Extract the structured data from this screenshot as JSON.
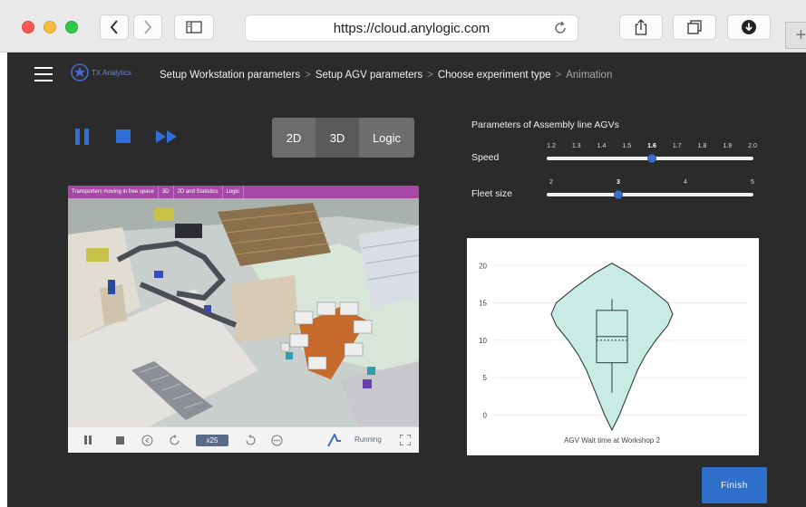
{
  "browser": {
    "url": "https://cloud.anylogic.com",
    "new_tab": "+"
  },
  "header": {
    "logo_text": "TX Analytics",
    "breadcrumbs": [
      {
        "label": "Setup Workstation parameters"
      },
      {
        "label": "Setup AGV parameters"
      },
      {
        "label": "Choose experiment type"
      },
      {
        "label": "Animation"
      }
    ],
    "separator": ">"
  },
  "view_modes": {
    "two_d": "2D",
    "three_d": "3D",
    "logic": "Logic"
  },
  "simulation": {
    "tabs": [
      "Transporters moving in free space",
      "3D",
      "2D and Statistics",
      "Logic"
    ],
    "speed_label": "x25",
    "status": "Running",
    "accent": "#a747a8"
  },
  "parameters": {
    "title": "Parameters of Assembly line AGVs",
    "speed": {
      "label": "Speed",
      "ticks": [
        "1.2",
        "1.3",
        "1.4",
        "1.5",
        "1.6",
        "1.7",
        "1.8",
        "1.9",
        "2.0"
      ],
      "value": 1.6,
      "min": 1.2,
      "max": 2.0
    },
    "fleet": {
      "label": "Fleet size",
      "ticks": [
        "2",
        "3",
        "4",
        "5"
      ],
      "value": 3,
      "min": 2,
      "max": 5
    }
  },
  "chart_data": {
    "type": "violin",
    "title": "",
    "xlabel": "AGV Wait time at Workshop 2",
    "ylabel": "",
    "ylim": [
      -2,
      21
    ],
    "yticks": [
      0,
      5,
      10,
      15,
      20
    ],
    "grid": true,
    "fill": "#c8ece3",
    "stroke": "#2f3f3a",
    "box": {
      "q1": 7,
      "median": 10.5,
      "mean": 10,
      "q3": 14,
      "whisker_low": 3,
      "whisker_high": 15.5
    },
    "density": [
      {
        "y": -2,
        "w": 0
      },
      {
        "y": 0,
        "w": 0.12
      },
      {
        "y": 2,
        "w": 0.22
      },
      {
        "y": 4,
        "w": 0.32
      },
      {
        "y": 6,
        "w": 0.42
      },
      {
        "y": 8,
        "w": 0.55
      },
      {
        "y": 10,
        "w": 0.72
      },
      {
        "y": 12,
        "w": 0.92
      },
      {
        "y": 13.5,
        "w": 1.0
      },
      {
        "y": 15,
        "w": 0.92
      },
      {
        "y": 17,
        "w": 0.62
      },
      {
        "y": 19,
        "w": 0.28
      },
      {
        "y": 20.3,
        "w": 0
      }
    ]
  },
  "actions": {
    "finish": "Finish"
  },
  "colors": {
    "app_bg": "#2b2b2b",
    "primary": "#2e6fc9",
    "slider_thumb": "#3c6fc6"
  }
}
